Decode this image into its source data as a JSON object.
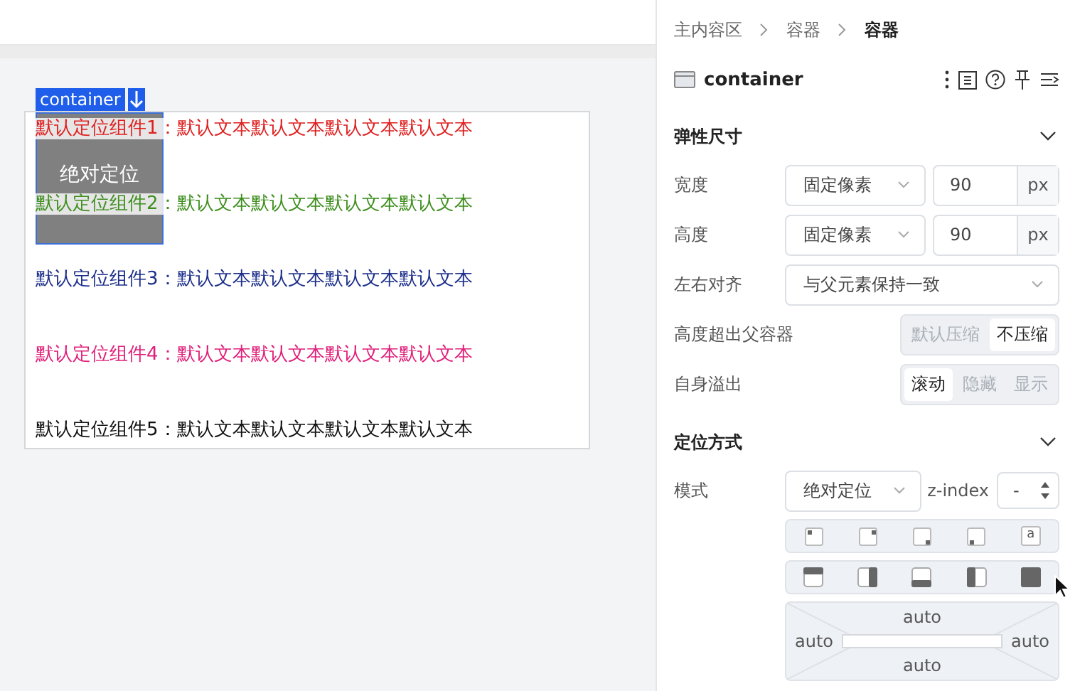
{
  "canvas": {
    "container_label": "container",
    "absolute_block_label": "绝对定位",
    "rows": [
      {
        "label": "默认定位组件1：",
        "text": "默认文本默认文本默认文本默认文本",
        "color": "#e02020"
      },
      {
        "label": "默认定位组件2：",
        "text": "默认文本默认文本默认文本默认文本",
        "color": "#3f8f1f"
      },
      {
        "label": "默认定位组件3：",
        "text": "默认文本默认文本默认文本默认文本",
        "color": "#1d2f8a"
      },
      {
        "label": "默认定位组件4：",
        "text": "默认文本默认文本默认文本默认文本",
        "color": "#e0207a"
      },
      {
        "label": "默认定位组件5：",
        "text": "默认文本默认文本默认文本默认文本",
        "color": "#111111"
      }
    ]
  },
  "panel": {
    "breadcrumb": [
      {
        "label": "主内容区",
        "selected": false
      },
      {
        "label": "容器",
        "selected": false
      },
      {
        "label": "容器",
        "selected": true
      }
    ],
    "component_name": "container",
    "sections": [
      {
        "title": "弹性尺寸",
        "expanded": true,
        "rows": [
          {
            "kind": "size",
            "label": "宽度",
            "mode": "固定像素",
            "value": "90",
            "unit": "px"
          },
          {
            "kind": "size",
            "label": "高度",
            "mode": "固定像素",
            "value": "90",
            "unit": "px"
          },
          {
            "kind": "select",
            "label": "左右对齐",
            "value": "与父元素保持一致"
          },
          {
            "kind": "segmented",
            "label": "高度超出父容器",
            "options": [
              {
                "label": "默认压缩",
                "selected": false
              },
              {
                "label": "不压缩",
                "selected": true
              }
            ]
          },
          {
            "kind": "segmented",
            "label": "自身溢出",
            "options": [
              {
                "label": "滚动",
                "selected": true
              },
              {
                "label": "隐藏",
                "selected": false
              },
              {
                "label": "显示",
                "selected": false
              }
            ]
          }
        ]
      },
      {
        "title": "定位方式",
        "expanded": true,
        "rows": [
          {
            "kind": "position",
            "label": "模式",
            "value": "绝对定位",
            "zindex_label": "z-index",
            "zindex_value": "-"
          }
        ]
      }
    ],
    "anchor_buttons": [
      {
        "kind": "top-left"
      },
      {
        "kind": "top-right"
      },
      {
        "kind": "bottom-right"
      },
      {
        "kind": "bottom-left"
      },
      {
        "kind": "text",
        "label": "a"
      }
    ],
    "fill_buttons": [
      {
        "kind": "top"
      },
      {
        "kind": "right"
      },
      {
        "kind": "bottom"
      },
      {
        "kind": "left"
      },
      {
        "kind": "full"
      }
    ],
    "offsets": {
      "top": "auto",
      "left": "auto",
      "right": "auto",
      "bottom": "auto"
    }
  }
}
